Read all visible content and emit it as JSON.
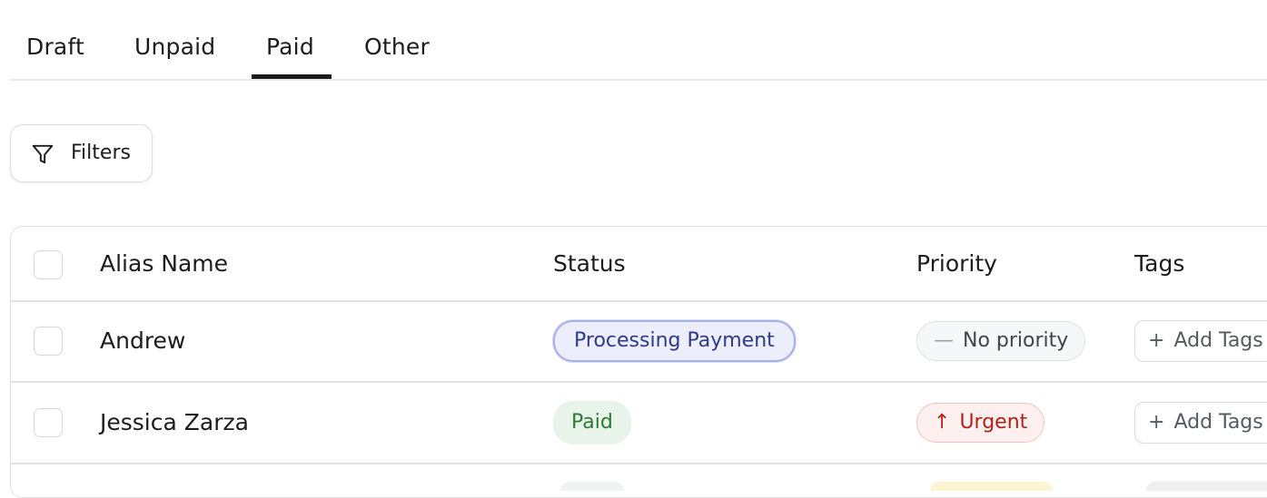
{
  "tabs": [
    {
      "label": "Draft",
      "active": false
    },
    {
      "label": "Unpaid",
      "active": false
    },
    {
      "label": "Paid",
      "active": true
    },
    {
      "label": "Other",
      "active": false
    }
  ],
  "toolbar": {
    "filters_label": "Filters",
    "filters_icon": "funnel-icon"
  },
  "table": {
    "columns": [
      "Alias Name",
      "Status",
      "Priority",
      "Tags"
    ],
    "rows": [
      {
        "alias": "Andrew",
        "status": "Processing Payment",
        "priority": "No priority",
        "priority_glyph": "—",
        "tags_label": "Add Tags",
        "tags_glyph": "+"
      },
      {
        "alias": "Jessica Zarza",
        "status": "Paid",
        "priority": "Urgent",
        "priority_glyph": "↑",
        "tags_label": "Add Tags",
        "tags_glyph": "+"
      }
    ]
  },
  "colors": {
    "processing_bg": "#eceefb",
    "processing_text": "#2f3a8a",
    "paid_bg": "#e8f3e9",
    "paid_text": "#2d7a36",
    "urgent_bg": "#fdf0ef",
    "urgent_text": "#b42318",
    "tab_active_underline": "#1c1c1c"
  }
}
